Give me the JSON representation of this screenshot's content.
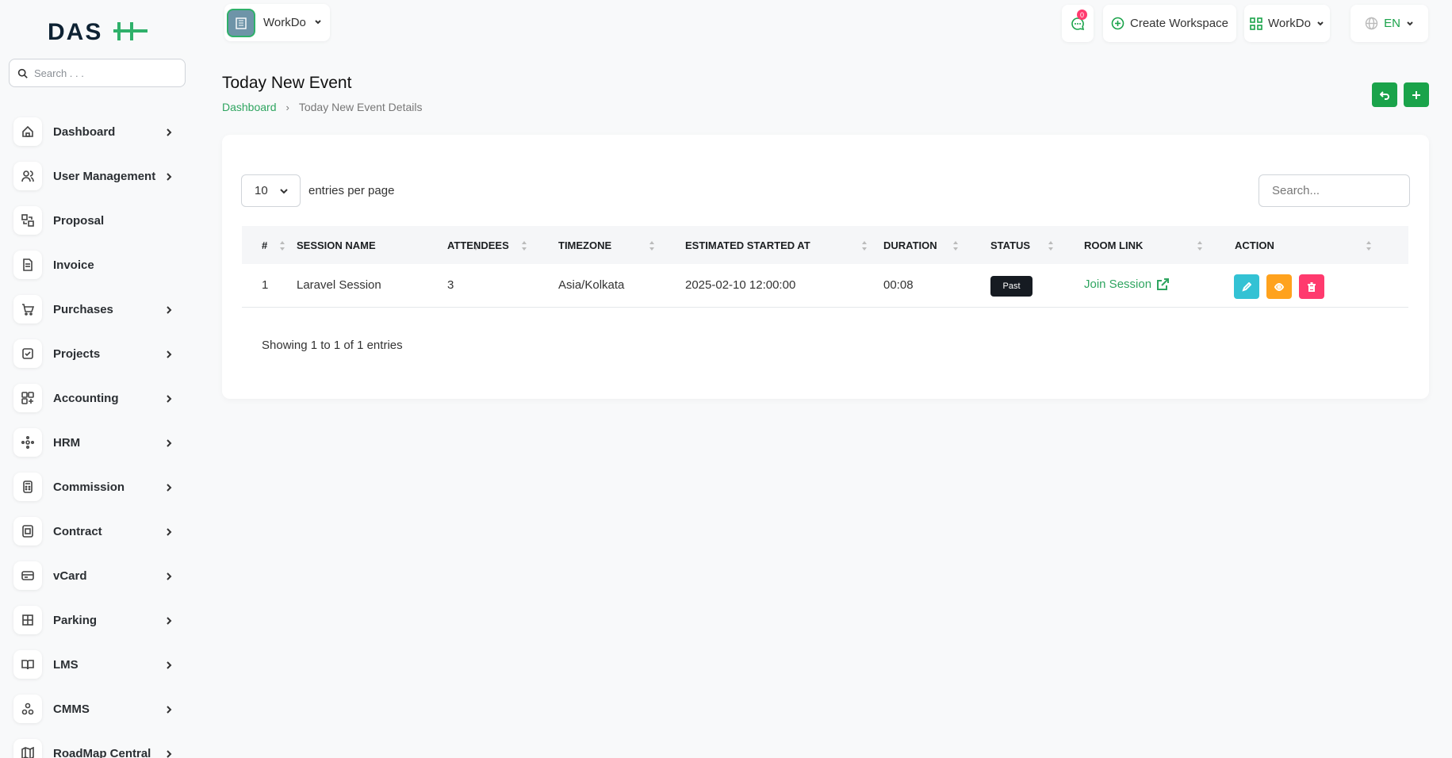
{
  "sidebar": {
    "logo_text": "DASH",
    "search_placeholder": "Search . . .",
    "items": [
      {
        "label": "Dashboard",
        "icon": "home-icon",
        "has_children": true
      },
      {
        "label": "User Management",
        "icon": "users-icon",
        "has_children": true
      },
      {
        "label": "Proposal",
        "icon": "proposal-icon",
        "has_children": false
      },
      {
        "label": "Invoice",
        "icon": "invoice-icon",
        "has_children": false
      },
      {
        "label": "Purchases",
        "icon": "cart-icon",
        "has_children": true
      },
      {
        "label": "Projects",
        "icon": "checkbox-icon",
        "has_children": true
      },
      {
        "label": "Accounting",
        "icon": "grid-icon",
        "has_children": true
      },
      {
        "label": "HRM",
        "icon": "hrm-icon",
        "has_children": true
      },
      {
        "label": "Commission",
        "icon": "calculator-icon",
        "has_children": true
      },
      {
        "label": "Contract",
        "icon": "contract-icon",
        "has_children": true
      },
      {
        "label": "vCard",
        "icon": "card-icon",
        "has_children": true
      },
      {
        "label": "Parking",
        "icon": "parking-icon",
        "has_children": true
      },
      {
        "label": "LMS",
        "icon": "book-icon",
        "has_children": true
      },
      {
        "label": "CMMS",
        "icon": "cmms-icon",
        "has_children": true
      },
      {
        "label": "RoadMap Central",
        "icon": "map-icon",
        "has_children": true
      }
    ]
  },
  "header": {
    "workspace_name": "WorkDo",
    "notification_count": "0",
    "create_workspace_label": "Create Workspace",
    "workspace_menu_label": "WorkDo",
    "language_label": "EN"
  },
  "page": {
    "title": "Today New Event",
    "breadcrumb": {
      "home": "Dashboard",
      "current": "Today New Event Details"
    }
  },
  "table": {
    "entries_value": "10",
    "entries_label": "entries per page",
    "search_placeholder": "Search...",
    "columns": [
      "#",
      "SESSION NAME",
      "ATTENDEES",
      "TIMEZONE",
      "ESTIMATED STARTED AT",
      "DURATION",
      "STATUS",
      "ROOM LINK",
      "ACTION"
    ],
    "rows": [
      {
        "num": "1",
        "session_name": "Laravel Session",
        "attendees": "3",
        "timezone": "Asia/Kolkata",
        "started_at": "2025-02-10 12:00:00",
        "duration": "00:08",
        "status": "Past",
        "room_link": "Join Session"
      }
    ],
    "showing_text": "Showing 1 to 1 of 1 entries"
  },
  "colors": {
    "primary": "#1aa34a",
    "link": "#2fa560",
    "edit": "#33c2d4",
    "view": "#ffa21d",
    "delete": "#ff3a6e",
    "status_past": "#161b22"
  }
}
